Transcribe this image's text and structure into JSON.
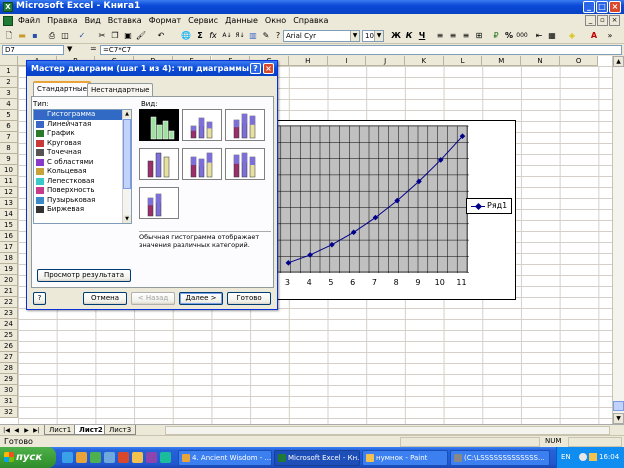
{
  "window": {
    "title": "Microsoft Excel - Книга1",
    "app_icon_glyph": "X"
  },
  "menu": [
    "Файл",
    "Правка",
    "Вид",
    "Вставка",
    "Формат",
    "Сервис",
    "Данные",
    "Окно",
    "Справка"
  ],
  "toolbar": {
    "zoom": "",
    "font_name": "Arial Cyr",
    "font_size": "10",
    "bold": "Ж",
    "italic": "К",
    "underline": "Ч",
    "sum": "Σ",
    "fx": "fx",
    "sort_asc": "А↓",
    "sort_desc": "Я↓",
    "percent": "%",
    "thousands": "000"
  },
  "formula_bar": {
    "name_box": "D7",
    "equals": "=",
    "formula": "=C7*C7"
  },
  "sheet": {
    "columns": [
      "A",
      "B",
      "C",
      "D",
      "E",
      "F",
      "G",
      "H",
      "I",
      "J",
      "K",
      "L",
      "M",
      "N",
      "O"
    ],
    "rows": [
      "1",
      "2",
      "3",
      "4",
      "5",
      "6",
      "7",
      "8",
      "9",
      "10",
      "11",
      "12",
      "13",
      "14",
      "15",
      "16",
      "17",
      "18",
      "19",
      "20",
      "21",
      "22",
      "23",
      "24",
      "25",
      "26",
      "27",
      "28",
      "29",
      "30",
      "31",
      "32"
    ]
  },
  "sheet_tabs": [
    "Лист1",
    "Лист2",
    "Лист3"
  ],
  "active_tab": "Лист2",
  "status": {
    "text": "Готово",
    "num": "NUM"
  },
  "taskbar": {
    "start_label": "пуск",
    "tasks": [
      {
        "label": "4. Ancient Wisdom - ...",
        "active": false
      },
      {
        "label": "Microsoft Excel - Кн...",
        "active": true
      },
      {
        "label": "нумнок - Paint",
        "active": false
      },
      {
        "label": "(C:\\LSSSSSSSSSSSSS...",
        "active": false
      }
    ],
    "lang": "EN",
    "clock": "16:04"
  },
  "dialog": {
    "title": "Мастер диаграмм (шаг 1 из 4): тип диаграммы",
    "tabs": [
      "Стандартные",
      "Нестандартные"
    ],
    "type_label": "Тип:",
    "view_label": "Вид:",
    "types": [
      "Гистограмма",
      "Линейчатая",
      "График",
      "Круговая",
      "Точечная",
      "С областями",
      "Кольцевая",
      "Лепестковая",
      "Поверхность",
      "Пузырьковая",
      "Биржевая"
    ],
    "selected_type": "Гистограмма",
    "description": "Обычная гистограмма отображает значения различных категорий.",
    "preview_button": "Просмотр результата",
    "help_button": "?",
    "buttons": {
      "cancel": "Отмена",
      "back": "< Назад",
      "next": "Далее >",
      "finish": "Готово"
    },
    "help_glyph": "?",
    "close_glyph": "×"
  },
  "chart_data": {
    "type": "line",
    "x": [
      3,
      4,
      5,
      6,
      7,
      8,
      9,
      10,
      11
    ],
    "series": [
      {
        "name": "Ряд1",
        "values": [
          9,
          16,
          25,
          36,
          49,
          64,
          81,
          100,
          121
        ]
      }
    ],
    "ylim": [
      0,
      130
    ],
    "grid": true,
    "legend": "right",
    "colors": {
      "line": "#00008b",
      "plot_bg": "#c0c0c0"
    }
  }
}
